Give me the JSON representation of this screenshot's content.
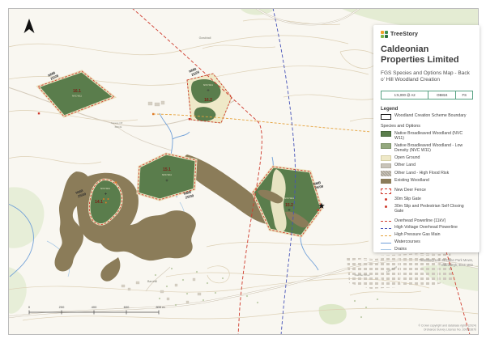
{
  "page": {
    "scale_labels": [
      "0",
      "200",
      "400",
      "600",
      "800 m"
    ],
    "attribution": {
      "line1": "© Crown copyright and database rights (2024)",
      "line2": "Ordnance Survey Licence No. 100053876"
    }
  },
  "panel": {
    "brand": "TreeStory",
    "client": "Caldeonian Properties Limited",
    "map_title": "FGS Species and Options Map - Back o' Hill Woodland Creation",
    "info_boxes": {
      "scale": "1:5,000 @ A2",
      "ref": "OB824",
      "code": "FS"
    },
    "legend_heading": "Legend",
    "species_heading": "Species and Options",
    "items": {
      "boundary": "Woodland Creation Scheme Boundary",
      "nbw": "Native Broadleaved Woodland (NVC W11)",
      "nbw_low": "Native Broadleaved Woodland - Low Density (NVC W11)",
      "open": "Open Ground",
      "other": "Other Land",
      "flood": "Other Land - High Flood Risk",
      "existing": "Existing Woodland",
      "fence": "New Deer Fence",
      "gate30": "30m Slip Gate",
      "gate_ped": "30m Slip and Pedestrian Self Closing Gate",
      "power11": "Overhead Powerline (11kV)",
      "power_hv": "High Voltage Overhead Powerline",
      "gas": "High Pressure Gas Main",
      "water": "Watercourses",
      "drains": "Drains"
    },
    "address_line1": "TreeStory Ltd.  39 Dean Park Mews,",
    "address_line2": "Edinburgh, EH4 1ED"
  },
  "map": {
    "nmb": [
      {
        "l1": "NMB",
        "l2": "25/28"
      },
      {
        "l1": "NMB",
        "l2": "25/26"
      },
      {
        "l1": "NMB",
        "l2": "25/09"
      },
      {
        "l1": "NMB",
        "l2": "25/09"
      },
      {
        "l1": "NMB",
        "l2": "25/08"
      }
    ],
    "compartments": [
      {
        "id": "16.1",
        "sub": "NVC W11"
      },
      {
        "id": "16.2",
        "sub": "NVC W11"
      },
      {
        "id": "15.1",
        "sub": "NVC W11"
      },
      {
        "id": "15.2",
        "sub": "NVC W11"
      },
      {
        "id": "14.1",
        "sub": "NVC W11"
      }
    ],
    "places": {
      "p1": "Gowkhall",
      "p2": "Access Off",
      "p3": "B8049",
      "p4": "Barnhill",
      "p5": "Allander Drive",
      "p6": "Firth Road"
    }
  },
  "colors": {
    "woodland": "#5a7d4c",
    "woodland_low": "#93a87e",
    "open_ground": "#efe9c8",
    "other_land": "#c9c4ba",
    "existing_wood": "#8b7c59",
    "fence_red": "#cf3a2c",
    "hv_blue": "#4653b8",
    "gas_orange": "#e5a23c",
    "water_blue": "#6f9fd8",
    "drain_blue": "#a9c9e6",
    "brand_teal": "#57a182"
  }
}
